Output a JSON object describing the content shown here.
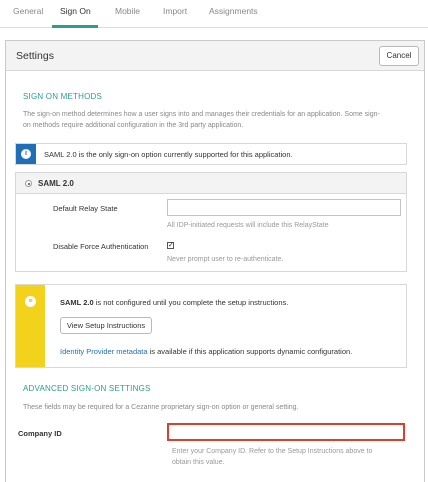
{
  "tabs": [
    {
      "label": "General",
      "active": false
    },
    {
      "label": "Sign On",
      "active": true
    },
    {
      "label": "Mobile",
      "active": false
    },
    {
      "label": "Import",
      "active": false
    },
    {
      "label": "Assignments",
      "active": false
    }
  ],
  "settings": {
    "title": "Settings",
    "cancel_label": "Cancel"
  },
  "sign_on_methods": {
    "title": "SIGN ON METHODS",
    "description_line1": "The sign-on method determines how a user signs into and manages their credentials for an application. Some sign-",
    "description_line2": "on methods require additional configuration in the 3rd party application.",
    "info_text": "SAML 2.0 is the only sign-on option currently supported for this application.",
    "saml_label": "SAML 2.0",
    "relay_state_label": "Default Relay State",
    "relay_state_value": "",
    "relay_state_hint": "All IDP-initiated requests will include this RelayState",
    "disable_force_auth_label": "Disable Force Authentication",
    "disable_force_auth_checked": true,
    "disable_force_auth_hint": "Never prompt user to re-authenticate."
  },
  "setup_notice": {
    "text_bold": "SAML 2.0",
    "text_rest": " is not configured until you complete the setup instructions.",
    "button_label": "View Setup Instructions",
    "idp_link": "Identity Provider metadata",
    "idp_rest": " is available if this application supports dynamic configuration."
  },
  "advanced": {
    "title": "ADVANCED SIGN-ON SETTINGS",
    "description": "These fields may be required for a Cezanne proprietary sign-on option or general setting.",
    "company_id_label": "Company ID",
    "company_id_value": "",
    "company_id_hint_line1": "Enter your Company ID. Refer to the Setup Instructions above to",
    "company_id_hint_line2": "obtain this value."
  },
  "colors": {
    "accent": "#2b9e8c",
    "info": "#1f6fb6",
    "warning": "#f2d21b",
    "highlight": "#e23c2c"
  }
}
